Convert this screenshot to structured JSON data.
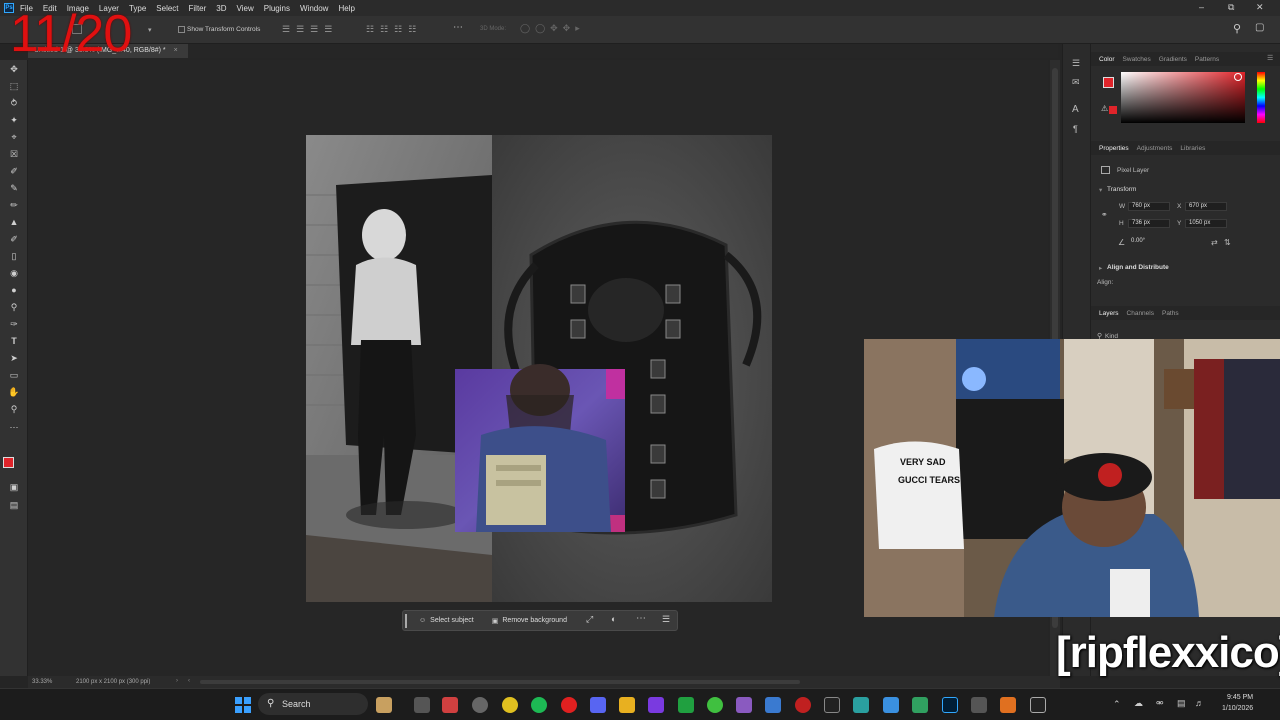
{
  "menubar": {
    "app_icon": "photoshop-logo",
    "items": [
      "File",
      "Edit",
      "Image",
      "Layer",
      "Type",
      "Select",
      "Filter",
      "3D",
      "View",
      "Plugins",
      "Window",
      "Help"
    ]
  },
  "options_bar": {
    "show_transform_label": "Show Transform Controls",
    "mode_3d_label": "3D Mode:"
  },
  "document": {
    "tab_title": "Untitled-1 @ 33.3% (IMG_...40, RGB/8#) *"
  },
  "status": {
    "zoom": "33.33%",
    "doc_size": "2100 px x 2100 px (300 ppi)"
  },
  "color_panel": {
    "tabs": [
      "Color",
      "Swatches",
      "Gradients",
      "Patterns"
    ],
    "foreground": "#e0242a",
    "background": "#ffffff"
  },
  "properties_panel": {
    "tabs": [
      "Properties",
      "Adjustments",
      "Libraries"
    ],
    "layer_type": "Pixel Layer",
    "transform_header": "Transform",
    "w_label": "W",
    "w_value": "760 px",
    "h_label": "H",
    "h_value": "736 px",
    "x_label": "X",
    "x_value": "670 px",
    "y_label": "Y",
    "y_value": "1050 px",
    "angle_value": "0.00°",
    "align_header": "Align and Distribute",
    "align_label": "Align:"
  },
  "layers_panel": {
    "tabs": [
      "Layers",
      "Channels",
      "Paths"
    ],
    "filter_label": "Kind"
  },
  "context_bar": {
    "select_subject": "Select subject",
    "remove_background": "Remove background"
  },
  "overlay": {
    "counter": "11/20",
    "handle": "[ripflexxico]",
    "counter_color": "#e01010"
  },
  "webcam": {
    "shirt_text_1": "VERY SAD",
    "shirt_text_2": "GUCCI TEARS"
  },
  "taskbar": {
    "search_label": "Search",
    "time": "9:45 PM",
    "date": "1/10/2026"
  }
}
